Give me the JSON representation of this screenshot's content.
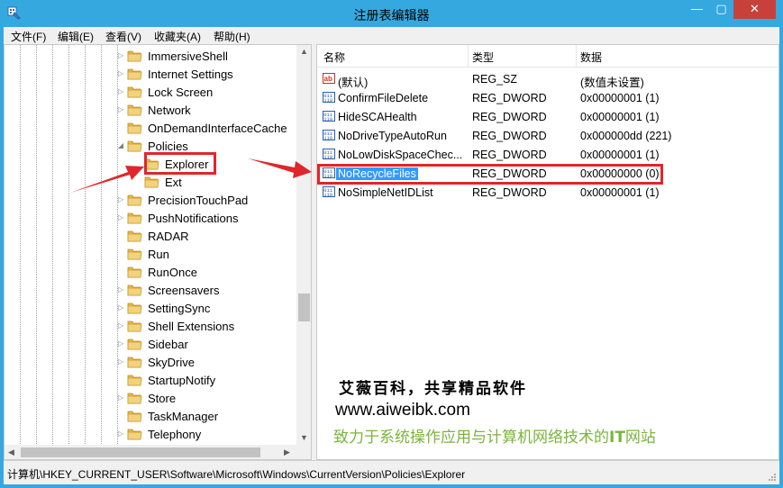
{
  "window": {
    "title": "注册表编辑器",
    "controls": {
      "minimize": "—",
      "maximize": "▢",
      "close": "✕"
    }
  },
  "menu": [
    "文件(F)",
    "编辑(E)",
    "查看(V)",
    "收藏夹(A)",
    "帮助(H)"
  ],
  "tree": [
    {
      "label": "ImmersiveShell",
      "expander": "collapsed"
    },
    {
      "label": "Internet Settings",
      "expander": "collapsed"
    },
    {
      "label": "Lock Screen",
      "expander": "collapsed"
    },
    {
      "label": "Network",
      "expander": "collapsed"
    },
    {
      "label": "OnDemandInterfaceCache",
      "expander": "none"
    },
    {
      "label": "Policies",
      "expander": "expanded"
    },
    {
      "label": "Explorer",
      "expander": "none",
      "child": true,
      "selected": true
    },
    {
      "label": "Ext",
      "expander": "none",
      "child": true
    },
    {
      "label": "PrecisionTouchPad",
      "expander": "collapsed"
    },
    {
      "label": "PushNotifications",
      "expander": "collapsed"
    },
    {
      "label": "RADAR",
      "expander": "none"
    },
    {
      "label": "Run",
      "expander": "none"
    },
    {
      "label": "RunOnce",
      "expander": "none"
    },
    {
      "label": "Screensavers",
      "expander": "collapsed"
    },
    {
      "label": "SettingSync",
      "expander": "collapsed"
    },
    {
      "label": "Shell Extensions",
      "expander": "collapsed"
    },
    {
      "label": "Sidebar",
      "expander": "collapsed"
    },
    {
      "label": "SkyDrive",
      "expander": "collapsed"
    },
    {
      "label": "StartupNotify",
      "expander": "none"
    },
    {
      "label": "Store",
      "expander": "collapsed"
    },
    {
      "label": "TaskManager",
      "expander": "none"
    },
    {
      "label": "Telephony",
      "expander": "collapsed"
    }
  ],
  "columns": [
    "名称",
    "类型",
    "数据"
  ],
  "values": [
    {
      "icon": "string-value-icon",
      "name": "(默认)",
      "type": "REG_SZ",
      "data": "(数值未设置)"
    },
    {
      "icon": "dword-value-icon",
      "name": "ConfirmFileDelete",
      "type": "REG_DWORD",
      "data": "0x00000001 (1)"
    },
    {
      "icon": "dword-value-icon",
      "name": "HideSCAHealth",
      "type": "REG_DWORD",
      "data": "0x00000001 (1)"
    },
    {
      "icon": "dword-value-icon",
      "name": "NoDriveTypeAutoRun",
      "type": "REG_DWORD",
      "data": "0x000000dd (221)"
    },
    {
      "icon": "dword-value-icon",
      "name": "NoLowDiskSpaceChec...",
      "type": "REG_DWORD",
      "data": "0x00000001 (1)"
    },
    {
      "icon": "dword-value-icon",
      "name": "NoRecycleFiles",
      "type": "REG_DWORD",
      "data": "0x00000000 (0)",
      "selected": true
    },
    {
      "icon": "dword-value-icon",
      "name": "NoSimpleNetIDList",
      "type": "REG_DWORD",
      "data": "0x00000001 (1)"
    }
  ],
  "watermark": {
    "line1": "艾薇百科，共享精品软件",
    "line2": "www.aiweibk.com",
    "line3_before": "致力于系统操作应用与计算机网络技术的",
    "line3_bold": "IT",
    "line3_after": "网站"
  },
  "status_path": "计算机\\HKEY_CURRENT_USER\\Software\\Microsoft\\Windows\\CurrentVersion\\Policies\\Explorer",
  "colors": {
    "accent": "#35a8e0",
    "highlight_box": "#e0262b",
    "selection": "#3399ff",
    "close": "#c7413a",
    "watermark_green": "#7ab53c"
  }
}
